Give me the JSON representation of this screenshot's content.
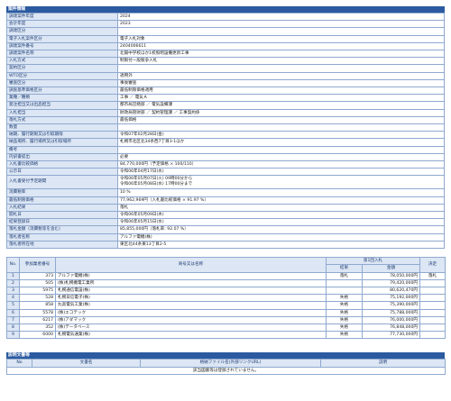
{
  "section1": {
    "title": "案件情報",
    "rows": [
      {
        "label": "調達案件年度",
        "value": "2024"
      },
      {
        "label": "会計年度",
        "value": "2023"
      },
      {
        "label": "調達区分",
        "value": ""
      },
      {
        "label": "電子入札案件区分",
        "value": "電子入札対象"
      },
      {
        "label": "調達案件番号",
        "value": "2404006611"
      },
      {
        "label": "調達案件名称",
        "value": "北陽中学校ほか1校照明設備更新工事"
      },
      {
        "label": "入札方式",
        "value": "制限付一般競争入札"
      },
      {
        "label": "契約区分",
        "value": ""
      },
      {
        "label": "WTO区分",
        "value": "適用外"
      },
      {
        "label": "審査区分",
        "value": "事後審査"
      },
      {
        "label": "調査基準価格区分",
        "value": "最低制限価格適用"
      },
      {
        "label": "業種／種類",
        "value": "工事 ／ 電気Ａ"
      },
      {
        "label": "発注担当又は出品担当",
        "value": "都市局営繕部 ／ 電気設備課"
      },
      {
        "label": "入札担当",
        "value": "財政局管財部 ／ 契約管理課 ／ 工事契約係"
      },
      {
        "label": "落札方式",
        "value": "最低価格"
      },
      {
        "label": "数量",
        "value": ""
      },
      {
        "label": "納期、履行期限又は引取期限",
        "value": "令和07年02月28日(金)"
      },
      {
        "label": "納品場所、履行場所又は引取場所",
        "value": "札幌市北区北34条西7丁目3-1ほか"
      },
      {
        "label": "備考",
        "value": ""
      },
      {
        "label": "内訳書提出",
        "value": "必要"
      },
      {
        "label": "入札書比較価格",
        "value": "84,770,000円（予定価格 × 100/110）"
      },
      {
        "label": "公示日",
        "value": "令和06年04月17日(水)"
      },
      {
        "label": "入札書受付予定期間",
        "value": [
          "令和06年05月07日(火) 09時00分から",
          "令和06年05月08日(水) 17時00分まで"
        ]
      },
      {
        "label": "消費税率",
        "value": "10 %"
      },
      {
        "label": "最低制限価格",
        "value": "77,962,969円（入札書比較価格 × 91.97 %）"
      },
      {
        "label": "入札結果",
        "value": "落札"
      },
      {
        "label": "開札日",
        "value": "令和06年05月09日(木)"
      },
      {
        "label": "結果登録日",
        "value": "令和06年05月15日(水)"
      },
      {
        "label": "落札金額（消費税等を含む）",
        "value": "85,855,000円（落札率: 92.07 %）"
      },
      {
        "label": "落札者名称",
        "value": "アルファ電機(株)"
      },
      {
        "label": "落札者所在地",
        "value": "東区北44条東13丁目2-5"
      }
    ]
  },
  "bids": {
    "headers": {
      "no": "No.",
      "code": "参加業者番号",
      "name": "商号又は名称",
      "round": "第1回入札",
      "result": "結果",
      "amount": "金額",
      "decision": "決定"
    },
    "rows": [
      {
        "no": "1",
        "code": "373",
        "name": "アルファ電機(株)",
        "result": "落札",
        "amount": "78,050,000円",
        "decision": "落札"
      },
      {
        "no": "2",
        "code": "505",
        "name": "(株)札幌機電工業所",
        "result": "",
        "amount": "79,420,000円",
        "decision": ""
      },
      {
        "no": "3",
        "code": "5975",
        "name": "札幌通信電設(株)",
        "result": "",
        "amount": "80,620,470円",
        "decision": ""
      },
      {
        "no": "4",
        "code": "528",
        "name": "札幌日信電子(株)",
        "result": "失格",
        "amount": "75,192,000円",
        "decision": ""
      },
      {
        "no": "5",
        "code": "858",
        "name": "丸高電気工業(株)",
        "result": "失格",
        "amount": "75,390,000円",
        "decision": ""
      },
      {
        "no": "6",
        "code": "5578",
        "name": "(株)エコテック",
        "result": "失格",
        "amount": "75,788,000円",
        "decision": ""
      },
      {
        "no": "7",
        "code": "6217",
        "name": "(株)アダマック",
        "result": "失格",
        "amount": "76,000,000円",
        "decision": ""
      },
      {
        "no": "8",
        "code": "352",
        "name": "(株)データベース",
        "result": "失格",
        "amount": "76,848,000円",
        "decision": ""
      },
      {
        "no": "9",
        "code": "6000",
        "name": "札幌電気通業(株)",
        "result": "失格",
        "amount": "77,730,000円",
        "decision": ""
      }
    ]
  },
  "section2": {
    "title": "説明文書等",
    "headers": {
      "no": "No",
      "doc": "文書名",
      "file": "格納ファイル名(外部リンクURL)",
      "desc": "説明"
    },
    "empty_message": "該当図書等は登録されていません。"
  }
}
